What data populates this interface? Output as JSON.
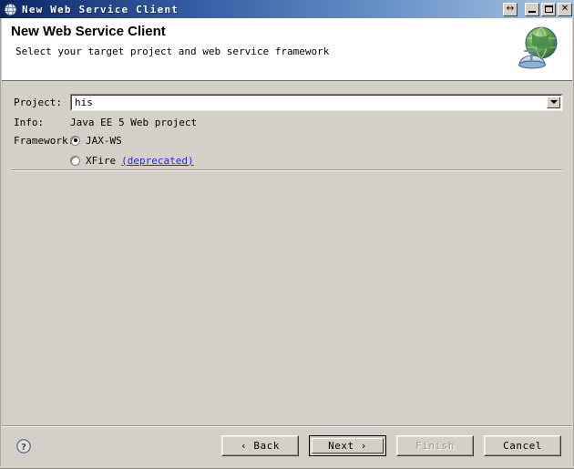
{
  "window": {
    "title": "New Web Service Client",
    "title_icon": "globe-window-icon",
    "controls": {
      "resize_label": "↔",
      "resize_name": "restore-size-icon",
      "minimize_name": "minimize-icon",
      "maximize_name": "maximize-icon",
      "close_label": "✕",
      "close_name": "close-icon"
    }
  },
  "header": {
    "title": "New Web Service Client",
    "subtitle": "Select your target project and web service framework",
    "banner_icon": "web-service-globe-icon"
  },
  "form": {
    "project": {
      "label": "Project:",
      "value": "his",
      "placeholder": ""
    },
    "info": {
      "label": "Info:",
      "value": "Java EE 5 Web project"
    },
    "framework": {
      "label": "Framework:",
      "options": [
        {
          "label": "JAX-WS",
          "selected": true,
          "note": ""
        },
        {
          "label": "XFire",
          "selected": false,
          "note": "(deprecated)"
        }
      ]
    }
  },
  "footer": {
    "help_label": "?",
    "buttons": {
      "back": "‹ Back",
      "next": "Next ›",
      "finish": "Finish",
      "cancel": "Cancel"
    }
  },
  "colors": {
    "title_gradient_start": "#0b2560",
    "title_gradient_end": "#a8c4e2",
    "dialog_background": "#d4d0c8",
    "header_background": "#ffffff",
    "link": "#2a2ad0",
    "disabled_text": "#9a968e"
  }
}
